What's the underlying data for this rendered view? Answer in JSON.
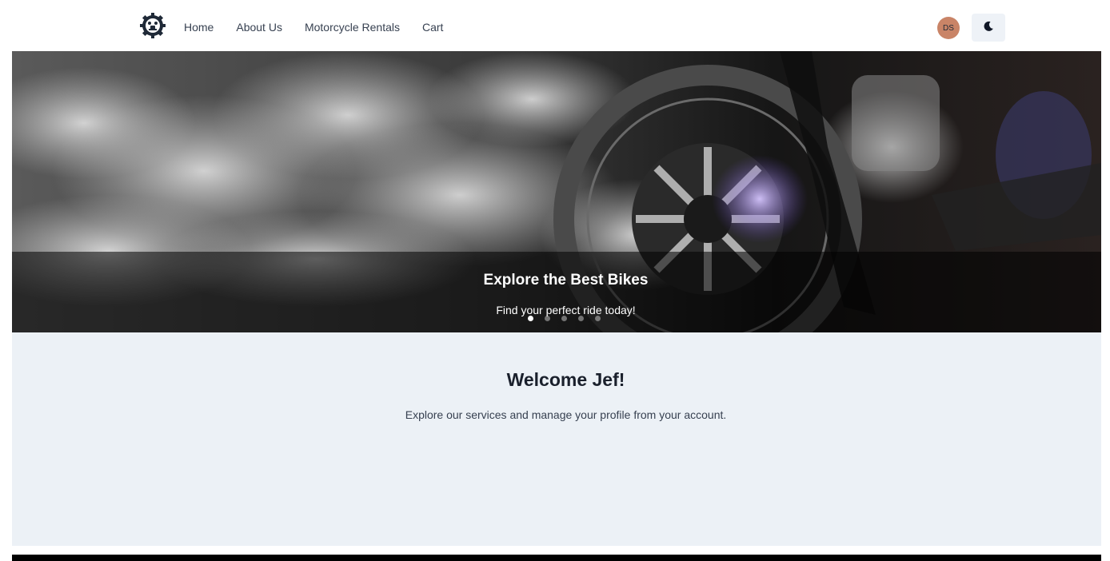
{
  "nav": {
    "links": [
      "Home",
      "About Us",
      "Motorcycle Rentals",
      "Cart"
    ],
    "avatar_initials": "DS",
    "theme_icon": "moon-icon",
    "logo_icon": "motorcycle-gear-logo-icon"
  },
  "hero": {
    "title": "Explore the Best Bikes",
    "subtitle": "Find your perfect ride today!",
    "active_slide": 1,
    "slide_count": 5
  },
  "welcome": {
    "title": "Welcome Jef!",
    "subtitle": "Explore our services and manage your profile from your account."
  },
  "colors": {
    "avatar_bg": "#c98467",
    "welcome_bg": "#ecf1f6",
    "theme_btn_bg": "#eef2f7"
  }
}
